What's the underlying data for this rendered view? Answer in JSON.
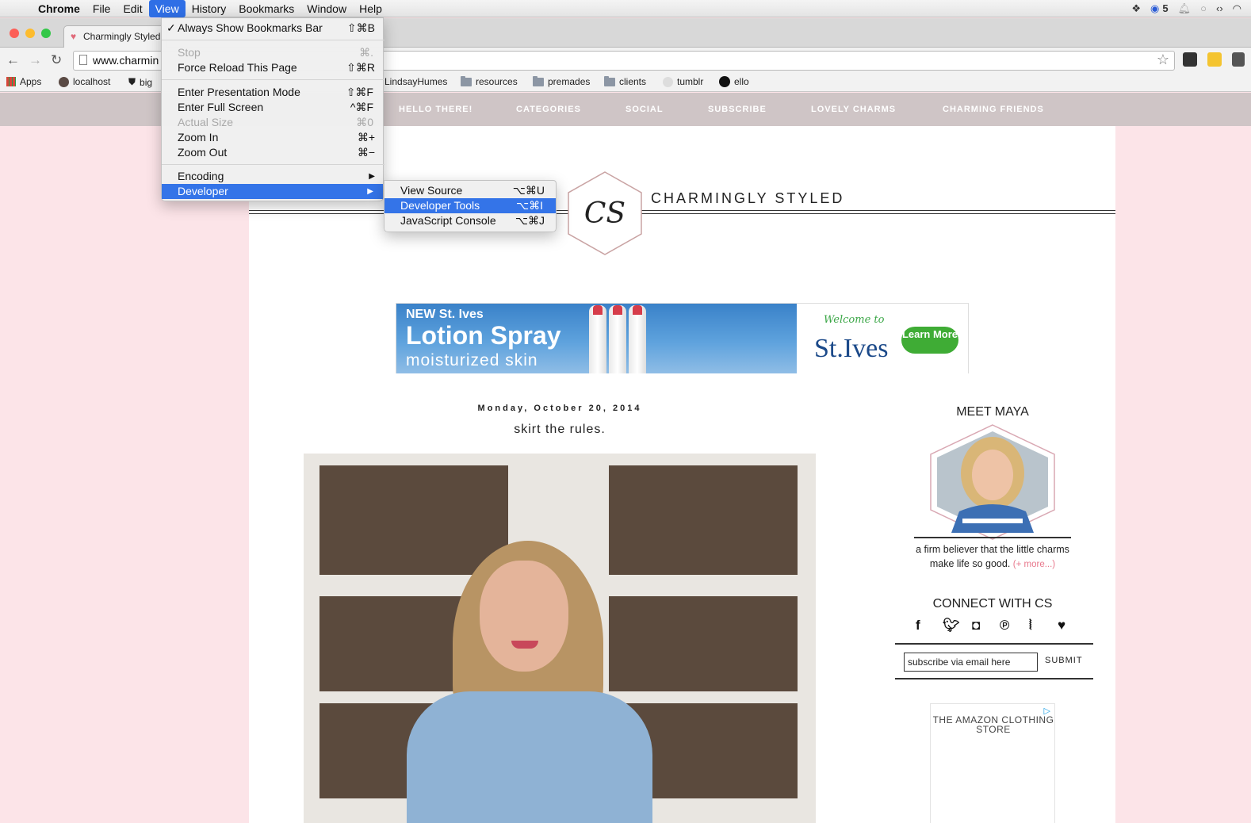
{
  "menubar": {
    "app": "Chrome",
    "items": [
      "File",
      "Edit",
      "View",
      "History",
      "Bookmarks",
      "Window",
      "Help"
    ],
    "active": "View",
    "badge_count": "5"
  },
  "tab": {
    "title": "Charmingly Styled"
  },
  "omnibox": {
    "url": "www.charmin"
  },
  "bookmarks": [
    {
      "label": "Apps"
    },
    {
      "label": "localhost"
    },
    {
      "label": "big"
    },
    {
      "label": "LindsayHumes"
    },
    {
      "label": "resources"
    },
    {
      "label": "premades"
    },
    {
      "label": "clients"
    },
    {
      "label": "tumblr"
    },
    {
      "label": "ello"
    }
  ],
  "view_menu": {
    "always_show_bookmarks": {
      "label": "Always Show Bookmarks Bar",
      "shortcut": "⇧⌘B"
    },
    "stop": {
      "label": "Stop",
      "shortcut": "⌘."
    },
    "force_reload": {
      "label": "Force Reload This Page",
      "shortcut": "⇧⌘R"
    },
    "presentation": {
      "label": "Enter Presentation Mode",
      "shortcut": "⇧⌘F"
    },
    "full_screen": {
      "label": "Enter Full Screen",
      "shortcut": "^⌘F"
    },
    "actual_size": {
      "label": "Actual Size",
      "shortcut": "⌘0"
    },
    "zoom_in": {
      "label": "Zoom In",
      "shortcut": "⌘+"
    },
    "zoom_out": {
      "label": "Zoom Out",
      "shortcut": "⌘−"
    },
    "encoding": {
      "label": "Encoding"
    },
    "developer": {
      "label": "Developer"
    }
  },
  "developer_menu": {
    "view_source": {
      "label": "View Source",
      "shortcut": "⌥⌘U"
    },
    "dev_tools": {
      "label": "Developer Tools",
      "shortcut": "⌥⌘I"
    },
    "js_console": {
      "label": "JavaScript Console",
      "shortcut": "⌥⌘J"
    }
  },
  "site": {
    "nav": [
      "HELLO THERE!",
      "CATEGORIES",
      "SOCIAL",
      "SUBSCRIBE",
      "LOVELY CHARMS",
      "CHARMING FRIENDS"
    ],
    "title": "CHARMINGLY STYLED",
    "logo_text": "CS"
  },
  "ad": {
    "new": "NEW St. Ives",
    "product": "Lotion Spray",
    "tagline": "moisturized skin",
    "welcome": "Welcome to",
    "brand": "St.Ives",
    "cta": "Learn More"
  },
  "post": {
    "date": "Monday, October 20, 2014",
    "title": "skirt the rules."
  },
  "sidebar": {
    "meet_title": "MEET MAYA",
    "about": "a firm believer that the little charms make life so good.",
    "more": "(+ more...)",
    "connect_title": "CONNECT WITH CS",
    "subscribe_placeholder": "subscribe via email here",
    "submit": "SUBMIT",
    "amazon": "THE AMAZON CLOTHING STORE"
  },
  "colors": {
    "page_bg": "#fce4e8",
    "nav_bg": "#cfc5c6",
    "menu_highlight": "#3474e8",
    "accent_pink": "#e8788c"
  }
}
